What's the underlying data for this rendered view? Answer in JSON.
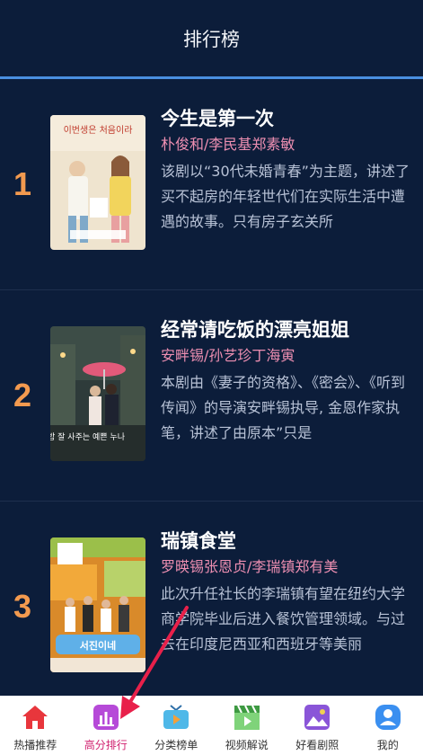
{
  "header": {
    "title": "排行榜"
  },
  "items": [
    {
      "rank": "1",
      "title": "今生是第一次",
      "cast": "朴俊和/李民基郑素敏",
      "desc": "该剧以“30代未婚青春”为主题，讲述了买不起房的年轻世代们在实际生活中遭遇的故事。只有房子玄关所",
      "poster_text": "이번생은 처음이라"
    },
    {
      "rank": "2",
      "title": "经常请吃饭的漂亮姐姐",
      "cast": "安畔锡/孙艺珍丁海寅",
      "desc": "本剧由《妻子的资格》、《密会》、《听到传闻》的导演安畔锡执导, 金恩作家执笔，讲述了由原本”只是",
      "poster_text": "밥 잘 사주는 예쁜 누나"
    },
    {
      "rank": "3",
      "title": "瑞镇食堂",
      "cast": "罗暎锡张恩贞/李瑞镇郑有美",
      "desc": "此次升任社长的李瑞镇有望在纽约大学商学院毕业后进入餐饮管理领域。与过去在印度尼西亚和西班牙等美丽",
      "poster_text": "서진이네"
    }
  ],
  "tabbar": {
    "tabs": [
      {
        "label": "热播推荐",
        "icon": "home-icon",
        "color": "#e8363c"
      },
      {
        "label": "高分排行",
        "icon": "chart-icon",
        "color": "#b64ad8",
        "active": true
      },
      {
        "label": "分类榜单",
        "icon": "tv-icon",
        "color": "#4fb8e8"
      },
      {
        "label": "视频解说",
        "icon": "clapperboard-icon",
        "color": "#6fc46a"
      },
      {
        "label": "好看剧照",
        "icon": "image-icon",
        "color": "#8a55d8"
      },
      {
        "label": "我的",
        "icon": "user-icon",
        "color": "#3a8ff0"
      }
    ]
  },
  "colors": {
    "background": "#0c1d3a",
    "rank": "#f39a4f",
    "cast": "#ee8fb2",
    "accent_line": "#4a8fe0",
    "active_tab": "#d0206f",
    "arrow": "#e8204a"
  }
}
